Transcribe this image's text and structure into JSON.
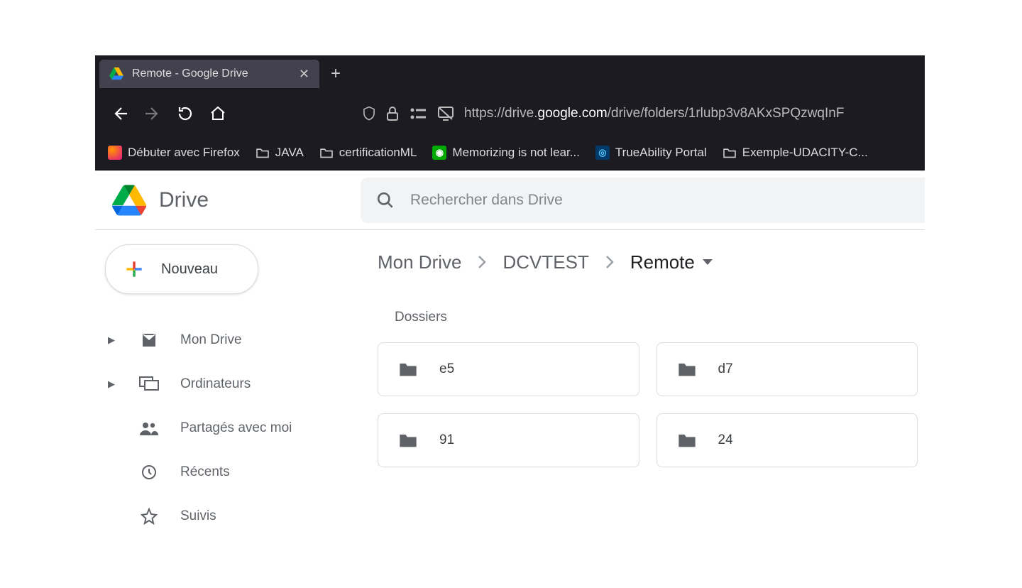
{
  "browser": {
    "tab_title": "Remote - Google Drive",
    "url_prefix": "https://drive.",
    "url_host": "google.com",
    "url_path": "/drive/folders/1rlubp3v8AKxSPQzwqInF"
  },
  "bookmarks": [
    {
      "label": "Débuter avec Firefox",
      "icon": "firefox"
    },
    {
      "label": "JAVA",
      "icon": "folder"
    },
    {
      "label": "certificationML",
      "icon": "folder"
    },
    {
      "label": "Memorizing is not lear...",
      "icon": "green"
    },
    {
      "label": "TrueAbility Portal",
      "icon": "blue"
    },
    {
      "label": "Exemple-UDACITY-C...",
      "icon": "folder"
    }
  ],
  "drive": {
    "app_name": "Drive",
    "search_placeholder": "Rechercher dans Drive",
    "new_button": "Nouveau"
  },
  "sidebar": [
    {
      "label": "Mon Drive",
      "expandable": true,
      "icon": "drive"
    },
    {
      "label": "Ordinateurs",
      "expandable": true,
      "icon": "computers"
    },
    {
      "label": "Partagés avec moi",
      "expandable": false,
      "icon": "shared"
    },
    {
      "label": "Récents",
      "expandable": false,
      "icon": "recent"
    },
    {
      "label": "Suivis",
      "expandable": false,
      "icon": "starred"
    }
  ],
  "breadcrumb": [
    {
      "label": "Mon Drive"
    },
    {
      "label": "DCVTEST"
    },
    {
      "label": "Remote",
      "current": true
    }
  ],
  "section_label": "Dossiers",
  "folders": [
    {
      "name": "e5"
    },
    {
      "name": "d7"
    },
    {
      "name": "91"
    },
    {
      "name": "24"
    }
  ]
}
